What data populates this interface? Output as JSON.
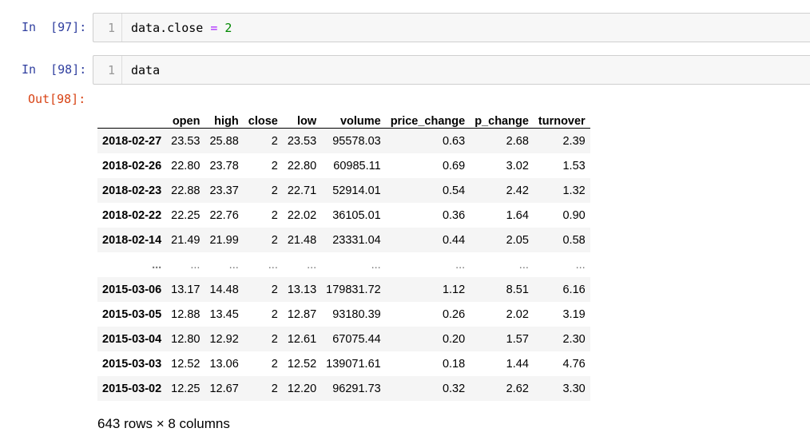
{
  "cells": [
    {
      "prompt": "In  [97]:",
      "line": "1",
      "code_var": "data.close",
      "code_op": "=",
      "code_val": "2"
    },
    {
      "prompt": "In  [98]:",
      "line": "1",
      "code_var": "data"
    }
  ],
  "output": {
    "prompt": "Out[98]:",
    "columns": [
      "",
      "open",
      "high",
      "close",
      "low",
      "volume",
      "price_change",
      "p_change",
      "turnover"
    ],
    "rows": [
      [
        "2018-02-27",
        "23.53",
        "25.88",
        "2",
        "23.53",
        "95578.03",
        "0.63",
        "2.68",
        "2.39"
      ],
      [
        "2018-02-26",
        "22.80",
        "23.78",
        "2",
        "22.80",
        "60985.11",
        "0.69",
        "3.02",
        "1.53"
      ],
      [
        "2018-02-23",
        "22.88",
        "23.37",
        "2",
        "22.71",
        "52914.01",
        "0.54",
        "2.42",
        "1.32"
      ],
      [
        "2018-02-22",
        "22.25",
        "22.76",
        "2",
        "22.02",
        "36105.01",
        "0.36",
        "1.64",
        "0.90"
      ],
      [
        "2018-02-14",
        "21.49",
        "21.99",
        "2",
        "21.48",
        "23331.04",
        "0.44",
        "2.05",
        "0.58"
      ],
      [
        "...",
        "...",
        "...",
        "...",
        "...",
        "...",
        "...",
        "...",
        "..."
      ],
      [
        "2015-03-06",
        "13.17",
        "14.48",
        "2",
        "13.13",
        "179831.72",
        "1.12",
        "8.51",
        "6.16"
      ],
      [
        "2015-03-05",
        "12.88",
        "13.45",
        "2",
        "12.87",
        "93180.39",
        "0.26",
        "2.02",
        "3.19"
      ],
      [
        "2015-03-04",
        "12.80",
        "12.92",
        "2",
        "12.61",
        "67075.44",
        "0.20",
        "1.57",
        "2.30"
      ],
      [
        "2015-03-03",
        "12.52",
        "13.06",
        "2",
        "12.52",
        "139071.61",
        "0.18",
        "1.44",
        "4.76"
      ],
      [
        "2015-03-02",
        "12.25",
        "12.67",
        "2",
        "12.20",
        "96291.73",
        "0.32",
        "2.62",
        "3.30"
      ]
    ],
    "shape_text": "643 rows × 8 columns"
  }
}
